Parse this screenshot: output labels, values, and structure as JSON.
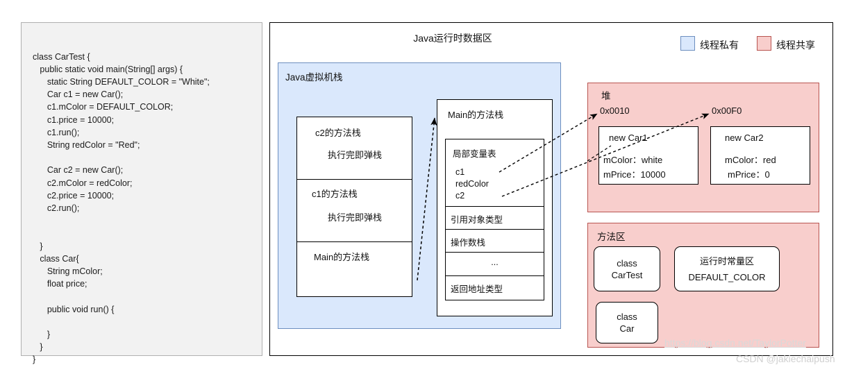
{
  "code_panel": {
    "code": "class CarTest {\n   public static void main(String[] args) {\n      static String DEFAULT_COLOR = \"White\";\n      Car c1 = new Car();\n      c1.mColor = DEFAULT_COLOR;\n      c1.price = 10000;\n      c1.run();\n      String redColor = \"Red\";\n\n      Car c2 = new Car();\n      c2.mColor = redColor;\n      c2.price = 10000;\n      c2.run();\n\n\n   }\n   class Car{\n      String mColor;\n      float price;\n\n      public void run() {\n\n      }\n   }\n}"
  },
  "diagram": {
    "title": "Java运行时数据区",
    "legend": [
      {
        "label": "线程私有",
        "color": "#dae8fc",
        "border": "#6c8ebf"
      },
      {
        "label": "线程共享",
        "color": "#f8cecc",
        "border": "#b85450"
      }
    ],
    "jvm_stack": {
      "label": "Java虚拟机栈",
      "frames": [
        {
          "title": "c2的方法栈",
          "sub": "执行完即弹栈"
        },
        {
          "title": "c1的方法栈",
          "sub": "执行完即弹栈"
        },
        {
          "title": "Main的方法栈",
          "sub": ""
        }
      ]
    },
    "main_frame": {
      "title": "Main的方法栈",
      "rows": [
        {
          "label": "局部变量表",
          "vars": [
            "c1",
            "redColor",
            "c2"
          ]
        },
        {
          "label": "引用对象类型"
        },
        {
          "label": "操作数栈"
        },
        {
          "label": "..."
        },
        {
          "label": "返回地址类型"
        }
      ]
    },
    "heap": {
      "label": "堆",
      "objects": [
        {
          "address": "0x0010",
          "title": "new Car1",
          "fields": [
            "mColor：white",
            "mPrice：10000"
          ]
        },
        {
          "address": "0x00F0",
          "title": "new Car2",
          "fields": [
            "mColor：red",
            "mPrice：0"
          ]
        }
      ]
    },
    "method_area": {
      "label": "方法区",
      "classes": [
        {
          "line1": "class",
          "line2": "CarTest"
        },
        {
          "line1": "class",
          "line2": "Car"
        }
      ],
      "constant_pool": {
        "title": "运行时常量区",
        "entry": "DEFAULT_COLOR"
      }
    }
  },
  "watermarks": {
    "url": "https://blog.csdn.net/TaylorPotter",
    "csdn": "CSDN @jakiechaipush"
  }
}
